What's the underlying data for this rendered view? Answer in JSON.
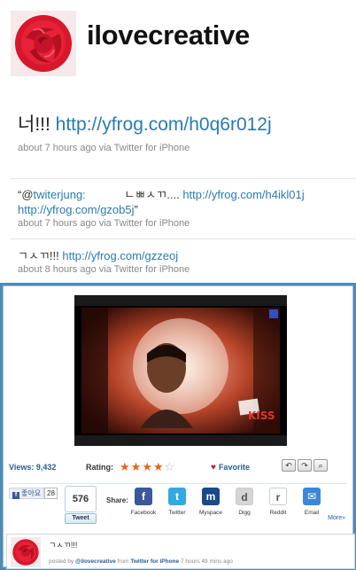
{
  "profile": {
    "name": "ilovecreative"
  },
  "main_tweet": {
    "text": "너!!!",
    "link": "http://yfrog.com/h0q6r012j",
    "meta": "about 7 hours ago via Twitter for iPhone"
  },
  "tweets": [
    {
      "quote_open": "“@",
      "mention": "twiterjung:",
      "text": "ㄴㅃㅅㄲ....",
      "link1": "http://yfrog.com/h4ikl01j",
      "link2": "http://yfrog.com/gzob5j",
      "quote_close": "”",
      "meta": "about 7 hours ago via Twitter for iPhone"
    },
    {
      "text": "ㄱㅅㄲ!!!",
      "link": "http://yfrog.com/gzzeoj",
      "meta": "about 8 hours ago via Twitter for iPhone"
    }
  ],
  "embed": {
    "video_watermark": "KISS",
    "views_label": "Views:",
    "views": "9,432",
    "rating_label": "Rating:",
    "rating_stars": 4,
    "rating_max": 5,
    "favorite_label": "Favorite",
    "like_label": "좋아요",
    "like_count": "28",
    "tweet_count": "576",
    "tweet_button": "Tweet",
    "share_label": "Share:",
    "share_items": [
      {
        "label": "Facebook",
        "icon": "facebook-icon",
        "color": "#3b5998",
        "glyph": "f"
      },
      {
        "label": "Twitter",
        "icon": "twitter-icon",
        "color": "#33a9e0",
        "glyph": "t"
      },
      {
        "label": "Myspace",
        "icon": "myspace-icon",
        "color": "#1b4a8a",
        "glyph": "m"
      },
      {
        "label": "Digg",
        "icon": "digg-icon",
        "color": "#d5d5d5",
        "glyph": "d"
      },
      {
        "label": "Reddit",
        "icon": "reddit-icon",
        "color": "#ffffff",
        "glyph": "r"
      },
      {
        "label": "Email",
        "icon": "email-icon",
        "color": "#3e86d6",
        "glyph": "✉"
      }
    ],
    "more_label": "More»",
    "comment": {
      "text": "ㄱㅅㄲ!!!",
      "posted_by": "posted by",
      "user": "@ilovecreative",
      "from": "from",
      "client": "Twitter for iPhone",
      "time": "7 hours 49 mins ago"
    }
  }
}
